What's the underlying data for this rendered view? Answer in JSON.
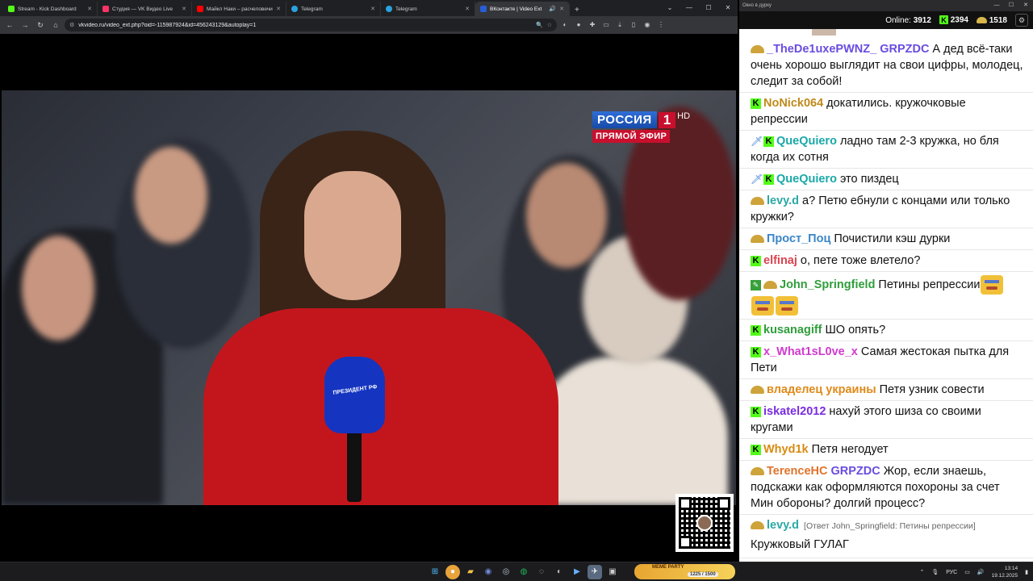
{
  "browser": {
    "tabs": [
      {
        "title": "Stream - Kick Dashboard",
        "color": "#53fc18"
      },
      {
        "title": "Студия — VK Видео Live",
        "color": "#ff3366"
      },
      {
        "title": "Майкл Наки – расчеловечива",
        "color": "#ff0000"
      },
      {
        "title": "Telegram",
        "color": "#2aa3e0"
      },
      {
        "title": "Telegram",
        "color": "#2aa3e0"
      },
      {
        "title": "ВКонтакте | Video Ext",
        "color": "#2a5cd6"
      }
    ],
    "url": "vkvideo.ru/video_ext.php?oid=-115987924&id=456243129&autoplay=1"
  },
  "video": {
    "channel_name": "РОССИЯ",
    "channel_number": "1",
    "hd": "HD",
    "live_label": "ПРЯМОЙ ЭФИР",
    "mic_label": "ПРЕЗИДЕНТ РФ"
  },
  "chat": {
    "window_title": "Окно в дурку",
    "online_label": "Online:",
    "online_count": "3912",
    "kick_count": "2394",
    "vk_count": "1518",
    "messages": [
      {
        "user": "_TheDe1uxePWNZ_",
        "color": "#6a4ce0",
        "badges": [
          "hat"
        ],
        "text": "GRPZDC А дед всё-таки очень хорошо выглядит на свои цифры, молодец, следит за собой!",
        "mention_color": "#6a4ce0",
        "mention": "GRPZDC"
      },
      {
        "user": "NoNick064",
        "color": "#c08a1a",
        "badges": [
          "kick"
        ],
        "text": "докатились. кружочковые репрессии"
      },
      {
        "user": "QueQuiero",
        "color": "#1aa8a8",
        "badges": [
          "sword",
          "kick"
        ],
        "text": "ладно там 2-3 кружка, но бля когда их сотня"
      },
      {
        "user": "QueQuiero",
        "color": "#1aa8a8",
        "badges": [
          "sword",
          "kick"
        ],
        "text": "это пиздец"
      },
      {
        "user": "levy.d",
        "color": "#2aa9a5",
        "badges": [
          "hat"
        ],
        "text": "а? Петю ебнули с концами или только кружки?"
      },
      {
        "user": "Прост_Поц",
        "color": "#3a86c8",
        "badges": [
          "hat"
        ],
        "text": "Почистили кэш дурки"
      },
      {
        "user": "elfinaj",
        "color": "#d9434f",
        "badges": [
          "kick"
        ],
        "text": "о, пете тоже влетело?"
      },
      {
        "user": "John_Springfield",
        "color": "#2f9e3b",
        "badges": [
          "pencil",
          "hat"
        ],
        "text": "Петины репрессии"
      },
      {
        "user": "kusanagiff",
        "color": "#2f9e3b",
        "badges": [
          "kick"
        ],
        "text": "ШО опять?"
      },
      {
        "user": "x_What1sL0ve_x",
        "color": "#d03ad0",
        "badges": [
          "kick"
        ],
        "text": "Самая жестокая пытка для Пети"
      },
      {
        "user": "владелец украины",
        "color": "#e08a1a",
        "badges": [
          "hat"
        ],
        "text": "Петя узник совести"
      },
      {
        "user": "iskatel2012",
        "color": "#7a2be0",
        "badges": [
          "kick"
        ],
        "text": "нахуй этого шиза со своими кругами"
      },
      {
        "user": "Whyd1k",
        "color": "#d78a10",
        "badges": [
          "kick"
        ],
        "text": "Петя негодует"
      },
      {
        "user": "TerenceHC",
        "color": "#e0732a",
        "badges": [
          "hat"
        ],
        "text": "Жор, если знаешь, подскажи как оформляются похороны за счет Мин обороны? долгий процесс?",
        "mention": "GRPZDC"
      },
      {
        "user": "levy.d",
        "color": "#2aa9a5",
        "badges": [
          "hat"
        ],
        "text": "Кружковый ГУЛАГ",
        "reply": "[Ответ John_Springfield: Петины репрессии]"
      }
    ]
  },
  "taskbar": {
    "widget_title": "MEME PARTY",
    "widget_progress": "1225 / 1500",
    "lang": "РУС",
    "time": "13:14",
    "date": "19.12.2025"
  }
}
